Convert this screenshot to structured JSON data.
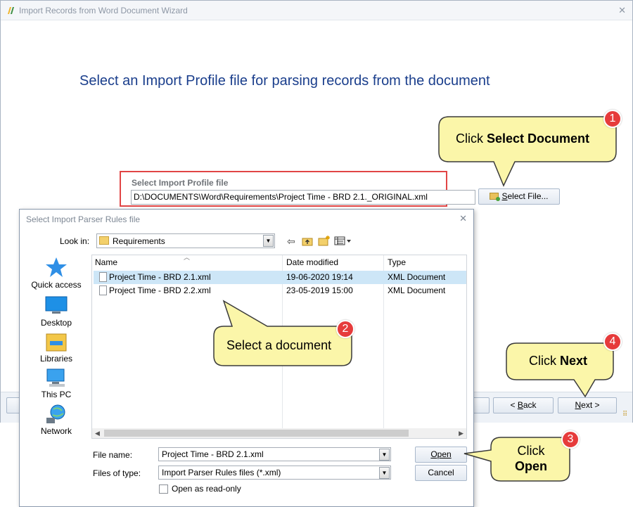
{
  "wizard": {
    "title": "Import Records from Word Document Wizard",
    "heading": "Select an Import Profile file for parsing records from the document",
    "profile_label": "Select Import Profile file",
    "profile_path": "D:\\DOCUMENTS\\Word\\Requirements\\Project Time - BRD 2.1._ORIGINAL.xml",
    "select_file_prefix": "S",
    "select_file_rest": "elect File...",
    "back_prefix": "< ",
    "back_accel": "B",
    "back_rest": "ack",
    "next_accel": "N",
    "next_rest": "ext >"
  },
  "dialog": {
    "title": "Select Import Parser Rules file",
    "look_in_label": "Look in:",
    "look_in_value": "Requirements",
    "places": [
      "Quick access",
      "Desktop",
      "Libraries",
      "This PC",
      "Network"
    ],
    "columns": [
      "Name",
      "Date modified",
      "Type"
    ],
    "files": [
      {
        "name": "Project Time - BRD 2.1.xml",
        "date": "19-06-2020 19:14",
        "type": "XML Document"
      },
      {
        "name": "Project Time - BRD 2.2.xml",
        "date": "23-05-2019 15:00",
        "type": "XML Document"
      }
    ],
    "file_name_label": "File name:",
    "file_name_value": "Project Time - BRD 2.1.xml",
    "files_of_type_label": "Files of type:",
    "files_of_type_value": "Import Parser Rules files (*.xml)",
    "open_label": "Open",
    "cancel_label": "Cancel",
    "readonly_label": "Open as read-only"
  },
  "callouts": [
    {
      "badge": "1",
      "pre": "Click ",
      "bold": "Select Document"
    },
    {
      "badge": "2",
      "pre": "Select a document",
      "bold": ""
    },
    {
      "badge": "3",
      "pre": "Click",
      "bold": "Open"
    },
    {
      "badge": "4",
      "pre": "Click ",
      "bold": "Next"
    }
  ],
  "colors": {
    "heading": "#1a3e8c",
    "highlight_box": "#e14545",
    "callout_fill": "#fbf6a9",
    "callout_border": "#3a3a3a",
    "badge": "#e63b3b",
    "selected_row": "#cde6f7"
  }
}
